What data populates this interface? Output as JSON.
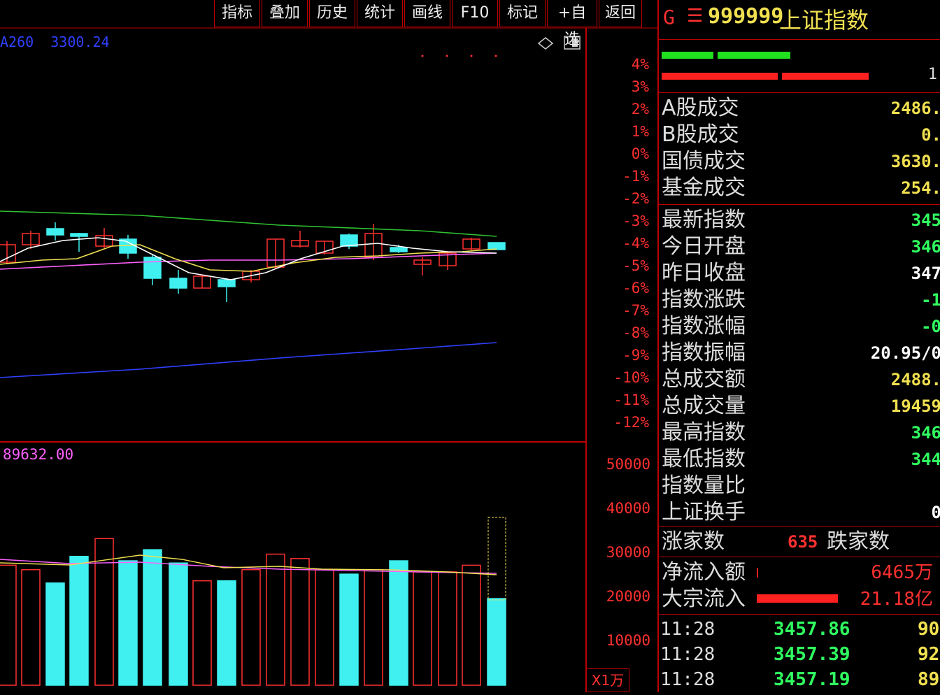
{
  "toolbar": {
    "buttons": [
      "指标",
      "叠加",
      "历史",
      "统计",
      "画线",
      "F10",
      "标记",
      "+自选",
      "返回"
    ]
  },
  "chart": {
    "ma_header_a": "A260",
    "ma_header_b": "3300.24",
    "vol_header": "89632.00",
    "percent_axis": [
      "4%",
      "3%",
      "2%",
      "1%",
      "0%",
      "-1%",
      "-2%",
      "-3%",
      "-4%",
      "-5%",
      "-6%",
      "-7%",
      "-8%",
      "-9%",
      "-10%",
      "-11%",
      "-12%"
    ],
    "volume_axis": [
      "50000",
      "40000",
      "30000",
      "20000",
      "10000"
    ],
    "volume_unit": "X1万",
    "colors": {
      "up": "#ff3030",
      "down": "#40f0f0",
      "ma5": "#ffffff",
      "ma10": "#f0e050",
      "ma20": "#ff60ff",
      "ma60": "#30c030",
      "ma250": "#3040ff"
    }
  },
  "chart_data": {
    "type": "candlestick",
    "candles": [
      {
        "dir": "up"
      },
      {
        "dir": "up"
      },
      {
        "dir": "down"
      },
      {
        "dir": "down"
      },
      {
        "dir": "up"
      },
      {
        "dir": "down"
      },
      {
        "dir": "down"
      },
      {
        "dir": "down"
      },
      {
        "dir": "up"
      },
      {
        "dir": "down"
      },
      {
        "dir": "up"
      },
      {
        "dir": "up"
      },
      {
        "dir": "up"
      },
      {
        "dir": "up"
      },
      {
        "dir": "down"
      },
      {
        "dir": "up"
      },
      {
        "dir": "down"
      },
      {
        "dir": "up"
      },
      {
        "dir": "up"
      },
      {
        "dir": "up"
      },
      {
        "dir": "down"
      }
    ],
    "volumes": [
      27000,
      26000,
      23000,
      29000,
      33000,
      28000,
      30500,
      27500,
      23500,
      23500,
      26000,
      29500,
      28500,
      26000,
      25000,
      26000,
      28000,
      25500,
      25500,
      27000,
      19500
    ]
  },
  "panel": {
    "code": "999999",
    "name": "上证指数",
    "g_label": "G",
    "menu_icon": "☰",
    "ratio_right": "1",
    "rows1": [
      {
        "label": "A股成交",
        "value": "2486."
      },
      {
        "label": "B股成交",
        "value": "0."
      },
      {
        "label": "国债成交",
        "value": "3630."
      },
      {
        "label": "基金成交",
        "value": "254."
      }
    ],
    "rows2": [
      {
        "label": "最新指数",
        "value": "345",
        "color": "#30ff60"
      },
      {
        "label": "今日开盘",
        "value": "346",
        "color": "#30ff60"
      },
      {
        "label": "昨日收盘",
        "value": "347",
        "color": "#ffffff"
      },
      {
        "label": "指数涨跌",
        "value": "-1",
        "color": "#30ff60"
      },
      {
        "label": "指数涨幅",
        "value": "-0",
        "color": "#30ff60"
      },
      {
        "label": "指数振幅",
        "value": "20.95/0",
        "color": "#ffffff"
      },
      {
        "label": "总成交额",
        "value": "2488.",
        "color": "#f0e050"
      },
      {
        "label": "总成交量",
        "value": "19459",
        "color": "#f0e050"
      },
      {
        "label": "最高指数",
        "value": "346",
        "color": "#30ff60"
      },
      {
        "label": "最低指数",
        "value": "344",
        "color": "#30ff60"
      },
      {
        "label": "指数量比",
        "value": "",
        "color": "#ffffff"
      },
      {
        "label": "上证换手",
        "value": "0",
        "color": "#ffffff"
      }
    ],
    "up_count_label": "涨家数",
    "up_count": "635",
    "down_count_label": "跌家数",
    "net_inflow_label": "净流入额",
    "net_inflow": "6465万",
    "block_inflow_label": "大宗流入",
    "block_inflow": "21.18亿",
    "trades": [
      {
        "time": "11:28",
        "price": "3457.86",
        "vol": "90"
      },
      {
        "time": "11:28",
        "price": "3457.39",
        "vol": "92"
      },
      {
        "time": "11:28",
        "price": "3457.19",
        "vol": "89"
      }
    ]
  }
}
